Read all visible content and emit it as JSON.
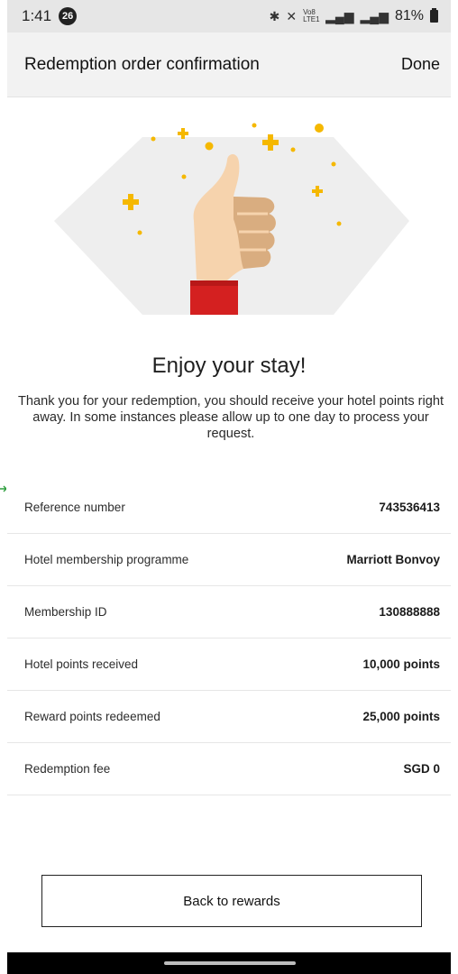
{
  "status_bar": {
    "time": "1:41",
    "notification_count": "26",
    "network_label": "Vo8 LTE1",
    "battery": "81%"
  },
  "app_bar": {
    "title": "Redemption order confirmation",
    "done_label": "Done"
  },
  "hero": {
    "illustration": "thumbs-up-icon",
    "accent_color": "#f5b800",
    "sleeve_color": "#d42020"
  },
  "confirmation": {
    "heading": "Enjoy your stay!",
    "message": "Thank you for your redemption, you should receive your hotel points right away. In some instances please allow up to one day to process your request."
  },
  "details": [
    {
      "label": "Reference number",
      "value": "743536413"
    },
    {
      "label": "Hotel membership programme",
      "value": "Marriott Bonvoy"
    },
    {
      "label": "Membership ID",
      "value": "130888888"
    },
    {
      "label": "Hotel points received",
      "value": "10,000 points"
    },
    {
      "label": "Reward points redeemed",
      "value": "25,000 points"
    },
    {
      "label": "Redemption fee",
      "value": "SGD 0"
    }
  ],
  "actions": {
    "back_label": "Back to rewards"
  }
}
